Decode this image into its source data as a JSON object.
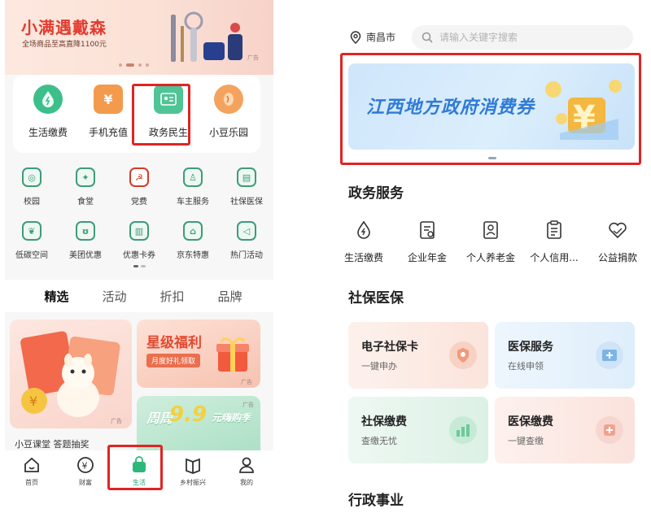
{
  "left": {
    "banner": {
      "title": "小满遇戴森",
      "subtitle": "全场商品至高直降1100元",
      "ad_tag": "广告"
    },
    "main_apps": [
      {
        "label": "生活缴费",
        "icon": "water-drop-icon"
      },
      {
        "label": "手机充值",
        "icon": "yuan-icon"
      },
      {
        "label": "政务民生",
        "icon": "id-card-icon"
      },
      {
        "label": "小豆乐园",
        "icon": "bean-icon"
      }
    ],
    "grid_row1": [
      {
        "label": "校园",
        "icon": "campus-icon",
        "glyph": "◎"
      },
      {
        "label": "食堂",
        "icon": "canteen-icon",
        "glyph": "✦"
      },
      {
        "label": "党费",
        "icon": "party-icon",
        "glyph": "☭"
      },
      {
        "label": "车主服务",
        "icon": "car-owner-icon",
        "glyph": "♙"
      },
      {
        "label": "社保医保",
        "icon": "social-insurance-icon",
        "glyph": "▤"
      }
    ],
    "grid_row2": [
      {
        "label": "低碳空间",
        "icon": "leaf-icon",
        "glyph": "❦"
      },
      {
        "label": "美团优惠",
        "icon": "rabbit-icon",
        "glyph": "ʊ"
      },
      {
        "label": "优惠卡券",
        "icon": "coupon-icon",
        "glyph": "▥"
      },
      {
        "label": "京东特惠",
        "icon": "shopping-bag-icon",
        "glyph": "⌂"
      },
      {
        "label": "热门活动",
        "icon": "megaphone-icon",
        "glyph": "◁"
      }
    ],
    "tabs": [
      {
        "label": "精选",
        "active": true
      },
      {
        "label": "活动",
        "active": false
      },
      {
        "label": "折扣",
        "active": false
      },
      {
        "label": "品牌",
        "active": false
      }
    ],
    "promos": {
      "card1_caption": "小豆课堂 答题抽奖",
      "card2_title": "星级福利",
      "card2_sub": "月度好礼领取",
      "card3_prefix": "周周",
      "card3_big": "9.9",
      "card3_suffix": "元嗨购季",
      "ad_tag": "广告"
    },
    "nav": [
      {
        "label": "首页",
        "icon": "home-icon",
        "active": false
      },
      {
        "label": "财富",
        "icon": "wealth-icon",
        "active": false
      },
      {
        "label": "生活",
        "icon": "life-bag-icon",
        "active": true
      },
      {
        "label": "乡村振兴",
        "icon": "book-icon",
        "active": false
      },
      {
        "label": "我的",
        "icon": "person-icon",
        "active": false
      }
    ]
  },
  "right": {
    "location": "南昌市",
    "search": {
      "placeholder": "请输入关键字搜索"
    },
    "banner_text": "江西地方政府消费券",
    "sections": {
      "gov": "政务服务",
      "social": "社保医保",
      "admin": "行政事业"
    },
    "gov_services": [
      {
        "label": "生活缴费",
        "icon": "water-drop-outline-icon"
      },
      {
        "label": "企业年金",
        "icon": "enterprise-pension-icon"
      },
      {
        "label": "个人养老金",
        "icon": "personal-pension-icon"
      },
      {
        "label": "个人信用...",
        "icon": "credit-report-icon"
      },
      {
        "label": "公益捐款",
        "icon": "charity-heart-icon"
      }
    ],
    "social_tiles": [
      {
        "title": "电子社保卡",
        "sub": "一键申办"
      },
      {
        "title": "医保服务",
        "sub": "在线申领"
      },
      {
        "title": "社保缴费",
        "sub": "查缴无忧"
      },
      {
        "title": "医保缴费",
        "sub": "一键查缴"
      }
    ]
  },
  "colors": {
    "accent_green": "#22a06b",
    "highlight_red": "#e02424"
  }
}
